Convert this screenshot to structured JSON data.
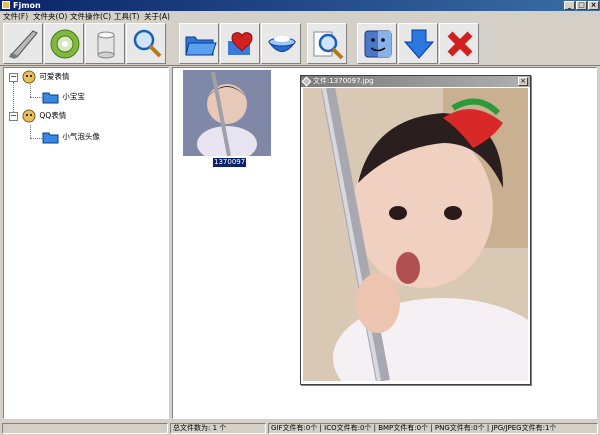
{
  "window": {
    "title": "Fjmon",
    "minimize": "_",
    "maximize": "□",
    "close": "×"
  },
  "menu": [
    "文件(F)",
    "文件夹(O)",
    "文件操作(C)",
    "工具(T)",
    "关于(A)"
  ],
  "toolbar": {
    "icons": [
      "brush-icon",
      "disc-icon",
      "cylinder-icon",
      "search-icon",
      "folder-icon",
      "heart-icon",
      "bowl-icon",
      "search-doc-icon",
      "finder-icon",
      "down-arrow-icon",
      "delete-icon"
    ]
  },
  "tree": {
    "expander_minus": "−",
    "groups": [
      {
        "label": "可爱表情",
        "child": "小宝宝"
      },
      {
        "label": "QQ表情",
        "child": "小气泡头像"
      }
    ]
  },
  "content": {
    "thumbnail_label": "1370097"
  },
  "preview": {
    "title": "文件:1370097.jpg",
    "close": "×"
  },
  "status": {
    "total": "总文件数为: 1 个",
    "types": "GIF文件有:0个 | ICO文件有:0个 | BMP文件有:0个 | PNG文件有:0个 | JPG/JPEG文件有:1个"
  },
  "colors": {
    "titlebar": "#0a246a",
    "accent_red": "#d02020",
    "accent_blue": "#2a6ad0"
  }
}
